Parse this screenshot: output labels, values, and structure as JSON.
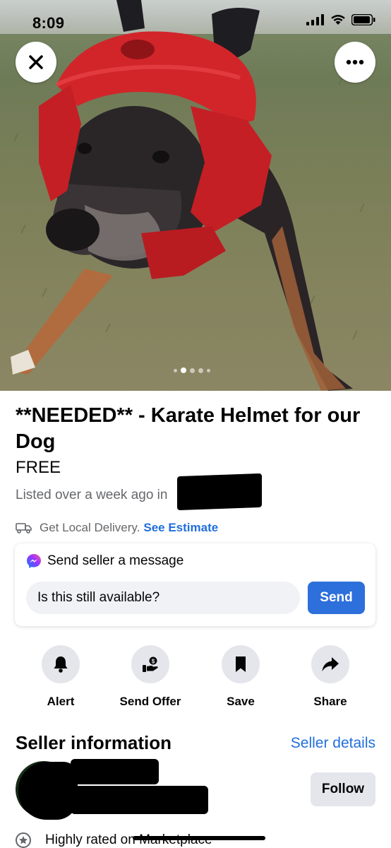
{
  "status_bar": {
    "time": "8:09"
  },
  "photo": {
    "page_count": 5,
    "active_index": 1
  },
  "listing": {
    "title": "**NEEDED** - Karate Helmet for our Dog",
    "price": "FREE",
    "listed_text": "Listed over a week ago in",
    "delivery_text": "Get Local Delivery.",
    "delivery_link": "See Estimate"
  },
  "message": {
    "heading": "Send seller a message",
    "input_value": "Is this still available?",
    "send_label": "Send"
  },
  "actions": [
    {
      "label": "Alert",
      "icon": "bell-icon"
    },
    {
      "label": "Send Offer",
      "icon": "offer-icon"
    },
    {
      "label": "Save",
      "icon": "bookmark-icon"
    },
    {
      "label": "Share",
      "icon": "share-icon"
    }
  ],
  "seller": {
    "section_title": "Seller information",
    "details_link": "Seller details",
    "follow_label": "Follow",
    "rating_text": "Highly rated on Marketplace"
  },
  "colors": {
    "accent": "#2d6fdb",
    "link": "#216fdb",
    "muted": "#65676b",
    "button_bg": "#e4e6eb"
  }
}
